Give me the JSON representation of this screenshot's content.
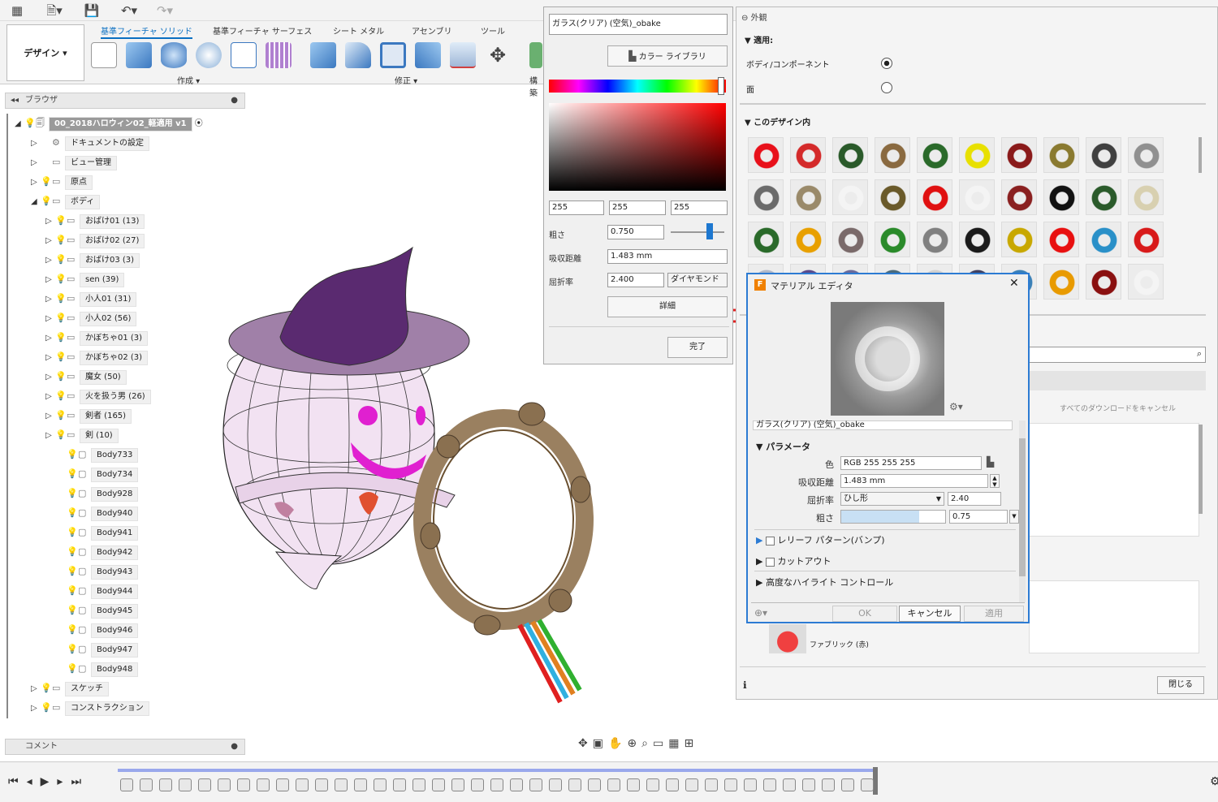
{
  "toolbar": {
    "design_label": "デザイン ▾"
  },
  "ribbon": {
    "tabs": [
      "基準フィーチャ ソリッド",
      "基準フィーチャ サーフェス",
      "シート メタル",
      "アセンブリ",
      "ツール"
    ],
    "groups": {
      "create": "作成 ▾",
      "modify": "修正 ▾",
      "construct": "構築"
    }
  },
  "browser": {
    "title": "ブラウザ",
    "root": "00_2018ハロウィン02_軽適用 v1",
    "items": [
      "ドキュメントの設定",
      "ビュー管理",
      "原点",
      "ボディ",
      "おばけ01 (13)",
      "おばけ02 (27)",
      "おばけ03 (3)",
      "sen (39)",
      "小人01 (31)",
      "小人02 (56)",
      "かぼちゃ01 (3)",
      "かぼちゃ02 (3)",
      "魔女 (50)",
      "火を扱う男 (26)",
      "剣者 (165)",
      "剣 (10)",
      "Body733",
      "Body734",
      "Body928",
      "Body940",
      "Body941",
      "Body942",
      "Body943",
      "Body944",
      "Body945",
      "Body946",
      "Body947",
      "Body948",
      "スケッチ",
      "コンストラクション"
    ]
  },
  "comment": {
    "title": "コメント"
  },
  "colorpanel": {
    "name": "ガラス(クリア) (空気)_obake",
    "library_button": "カラー ライブラリ",
    "rgb": [
      "255",
      "255",
      "255"
    ],
    "roughness_label": "粗さ",
    "roughness_value": "0.750",
    "absorption_label": "吸収距離",
    "absorption_value": "1.483 mm",
    "refraction_label": "屈折率",
    "refraction_value": "2.400",
    "refraction_type": "ダイヤモンド",
    "detail_button": "詳細",
    "done_button": "完了"
  },
  "appearance": {
    "title": "外観",
    "apply_label": "適用:",
    "body_component": "ボディ/コンポーネント",
    "face": "面",
    "in_design": "このデザイン内",
    "cancel_all_downloads": "すべてのダウンロードをキャンセル",
    "fabric_label": "ファブリック (赤)",
    "close_button": "閉じる"
  },
  "swatches": [
    "#e8101a",
    "#d42a2a",
    "#2a5a2a",
    "#8a6a40",
    "#2a6a2a",
    "#e8e000",
    "#8a1a1a",
    "#8a7a30",
    "#404040",
    "#909090",
    "#6a6a6a",
    "#9a8a6a",
    "#f4f4f4",
    "#6a5a2a",
    "#e01010",
    "#f4f4f4",
    "#8a2020",
    "#111111",
    "#2a5a2a",
    "#d8d0b0",
    "#2a6a2a",
    "#e8a000",
    "#7a6a6a",
    "#2a8a2a",
    "#808080",
    "#1a1a1a",
    "#c8a800",
    "#e81010",
    "#2a90c8",
    "#d81a1a",
    "#b0b8c8",
    "#5a4a8a",
    "#6a6a9a",
    "#4a6a7a",
    "#d0d0d0",
    "#404060",
    "#3a80b8",
    "#e89a00",
    "#8a1010",
    "#f4f4f4"
  ],
  "material_editor": {
    "title": "マテリアル エディタ",
    "name": "ガラス(クリア) (空気)_obake",
    "params_label": "パラメータ",
    "color_label": "色",
    "color_value": "RGB 255 255 255",
    "absorption_label": "吸収距離",
    "absorption_value": "1.483 mm",
    "refraction_label": "屈折率",
    "refraction_type": "ひし形",
    "refraction_value": "2.40",
    "roughness_label": "粗さ",
    "roughness_value": "0.75",
    "roughness_fill": 0.75,
    "relief": "レリーフ パターン(バンプ)",
    "cutout": "カットアウト",
    "highlight": "高度なハイライト コントロール",
    "ok": "OK",
    "cancel": "キャンセル",
    "apply": "適用"
  },
  "colors": {
    "accent": "#0a6fc2",
    "editor_border": "#2c7bd3",
    "arrow": "#e02020"
  }
}
